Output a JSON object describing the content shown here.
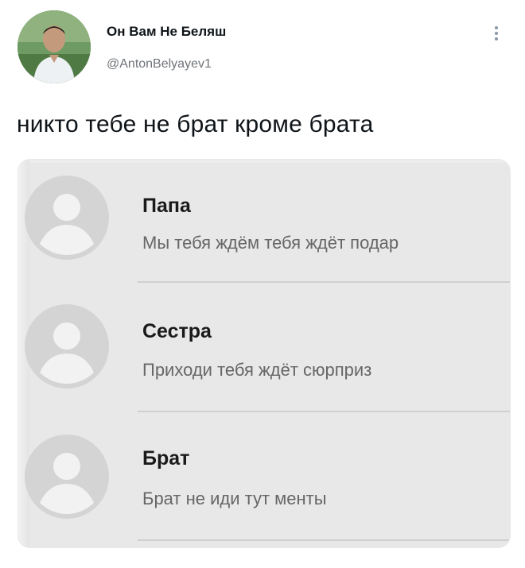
{
  "tweet": {
    "author_name": "Он Вам Не Беляш",
    "author_handle": "@AntonBelyayev1",
    "text": "никто тебе не брат кроме брата"
  },
  "media": {
    "chats": [
      {
        "name": "Папа",
        "preview": "Мы тебя ждём тебя ждёт подар"
      },
      {
        "name": "Сестра",
        "preview": "Приходи тебя ждёт сюрприз"
      },
      {
        "name": "Брат",
        "preview": "Брат не иди тут менты"
      }
    ]
  }
}
